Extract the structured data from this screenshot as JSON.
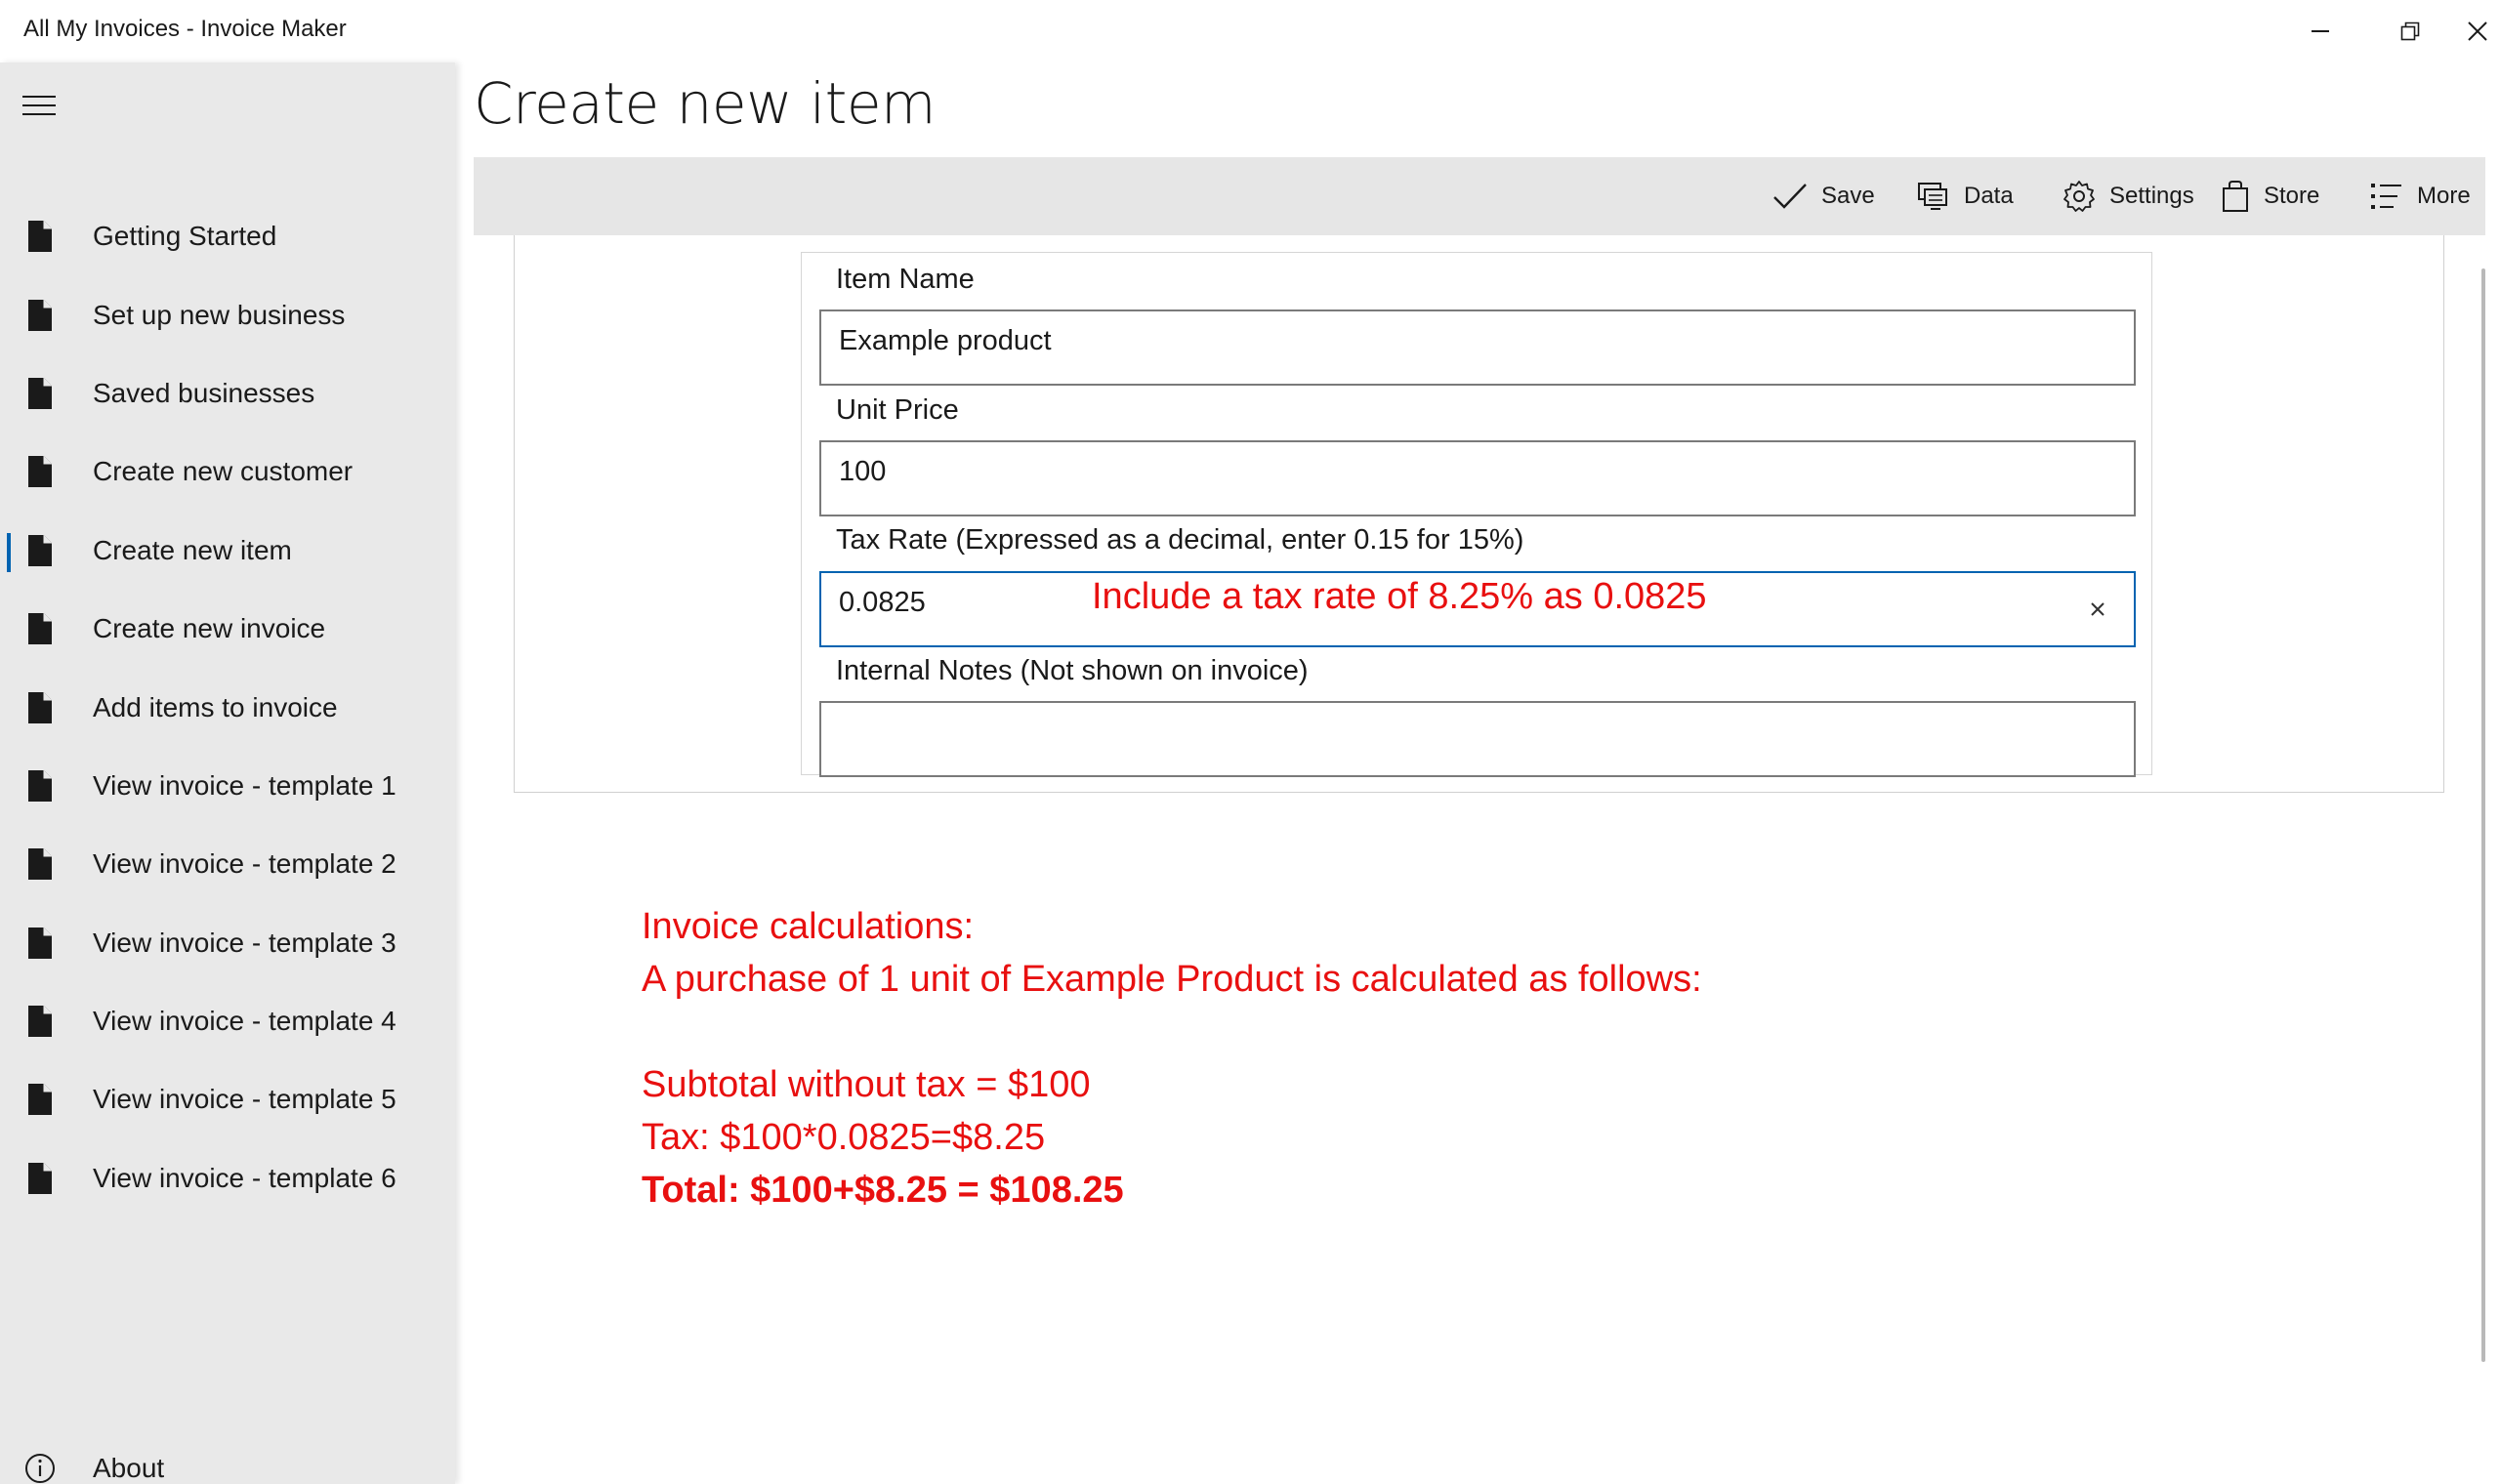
{
  "window": {
    "title": "All My Invoices - Invoice Maker"
  },
  "sidebar": {
    "items": [
      {
        "label": "Getting Started",
        "icon": "document-icon",
        "selected": false
      },
      {
        "label": "Set up new business",
        "icon": "document-icon",
        "selected": false
      },
      {
        "label": "Saved businesses",
        "icon": "document-icon",
        "selected": false
      },
      {
        "label": "Create new customer",
        "icon": "document-icon",
        "selected": false
      },
      {
        "label": "Create new item",
        "icon": "document-icon",
        "selected": true
      },
      {
        "label": "Create new invoice",
        "icon": "document-icon",
        "selected": false
      },
      {
        "label": "Add items to invoice",
        "icon": "document-icon",
        "selected": false
      },
      {
        "label": "View invoice - template 1",
        "icon": "document-icon",
        "selected": false
      },
      {
        "label": "View invoice - template 2",
        "icon": "document-icon",
        "selected": false
      },
      {
        "label": "View invoice - template 3",
        "icon": "document-icon",
        "selected": false
      },
      {
        "label": "View invoice - template 4",
        "icon": "document-icon",
        "selected": false
      },
      {
        "label": "View invoice - template 5",
        "icon": "document-icon",
        "selected": false
      },
      {
        "label": "View invoice - template 6",
        "icon": "document-icon",
        "selected": false
      }
    ],
    "about": {
      "label": "About",
      "icon": "info-icon"
    }
  },
  "page": {
    "title": "Create new item"
  },
  "commandbar": {
    "save": "Save",
    "data": "Data",
    "settings": "Settings",
    "store": "Store",
    "more": "More"
  },
  "form": {
    "item_name": {
      "label": "Item Name",
      "value": "Example product"
    },
    "unit_price": {
      "label": "Unit Price",
      "value": "100"
    },
    "tax_rate": {
      "label": "Tax Rate (Expressed as a decimal, enter 0.15 for 15%)",
      "value": "0.0825"
    },
    "internal_notes": {
      "label": "Internal Notes (Not shown on invoice)",
      "value": ""
    }
  },
  "annotation": {
    "tax_hint": "Include a tax rate of 8.25% as 0.0825",
    "calc_heading": "Invoice calculations:",
    "calc_intro": "A purchase of 1 unit of Example Product is calculated as follows:",
    "subtotal": "Subtotal without tax = $100",
    "tax": "Tax: $100*0.0825=$8.25",
    "total": "Total: $100+$8.25 = $108.25",
    "color": "#e81010"
  },
  "colors": {
    "accent": "#0063b1",
    "sidebar_bg": "#e9e9e9",
    "commandbar_bg": "#e6e6e6"
  }
}
